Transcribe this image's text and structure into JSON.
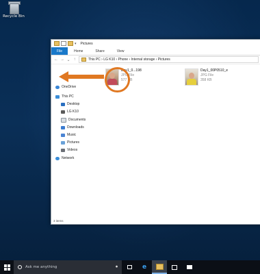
{
  "desktop": {
    "recycle_bin_label": "Recycle Bin"
  },
  "explorer": {
    "title": "Pictures",
    "ribbon_tabs": [
      "File",
      "Home",
      "Share",
      "View"
    ],
    "address_path": "This PC  ›  LG K10  ›  Phone  ›  Internal storage  ›  Pictures",
    "nav": {
      "onedrive": "OneDrive",
      "this_pc": "This PC",
      "desktop": "Desktop",
      "lg_k10": "LG K10",
      "documents": "Documents",
      "downloads": "Downloads",
      "music": "Music",
      "pictures": "Pictures",
      "videos": "Videos",
      "network": "Network"
    },
    "files": [
      {
        "name": "Day1_0...198",
        "type": "JPG File",
        "size": "577 KB"
      },
      {
        "name": "Day1_00P0510_e",
        "type": "JPG File",
        "size": "358 KB"
      }
    ],
    "status": "3 items"
  },
  "taskbar": {
    "search_placeholder": "Ask me anything"
  },
  "annotation_color": "#e07822"
}
